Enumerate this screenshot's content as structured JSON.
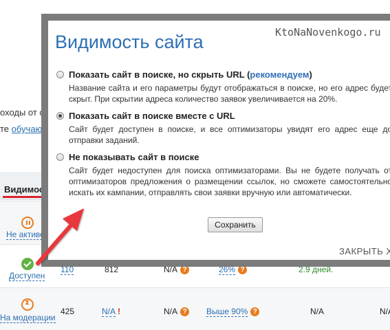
{
  "background": {
    "line1": "оходы от са",
    "line2_prefix": "те ",
    "line2_link": "обучающ",
    "table_header": "Видимост",
    "rows": [
      {
        "status": "Не активен"
      },
      {
        "status": "Доступен",
        "col1": "110",
        "col2": "812",
        "col3": "N/A",
        "col4": "26%",
        "col5": "2.9 дней."
      },
      {
        "status": "На модерации",
        "col1": "425",
        "col2": "N/A",
        "col3": "N/A",
        "col4": "Выше 90%",
        "col5": "N/A",
        "col6": "N/A"
      }
    ]
  },
  "modal": {
    "title": "Видимость сайта",
    "watermark": "KtoNaNovenkogo.ru",
    "options": [
      {
        "label": "Показать сайт в поиске, но скрыть URL (",
        "label_link": "рекомендуем",
        "label_end": ")",
        "description": "Название сайта и его параметры будут отображаться в поиске, но его адрес будет скрыт. При скрытии адреса количество заявок увеличивается на 20%.",
        "checked": false
      },
      {
        "label": "Показать сайт в поиске вместе с URL",
        "description": "Сайт будет доступен в поиске, и все оптимизаторы увидят его адрес еще до отправки заданий.",
        "checked": true
      },
      {
        "label": "Не показывать сайт в поиске",
        "description": "Сайт будет недоступен для поиска оптимизаторами. Вы не будете получать от оптимизаторов предложения о размещении ссылок, но сможете самостоятельно искать их кампании, отправлять свои заявки вручную или автоматически.",
        "checked": false
      }
    ],
    "save_label": "Сохранить",
    "close_label": "ЗАКРЫТЬ X"
  },
  "colors": {
    "accent": "#2f6fb5",
    "arrow": "#e8383d",
    "frame": "#7b7b7b"
  }
}
